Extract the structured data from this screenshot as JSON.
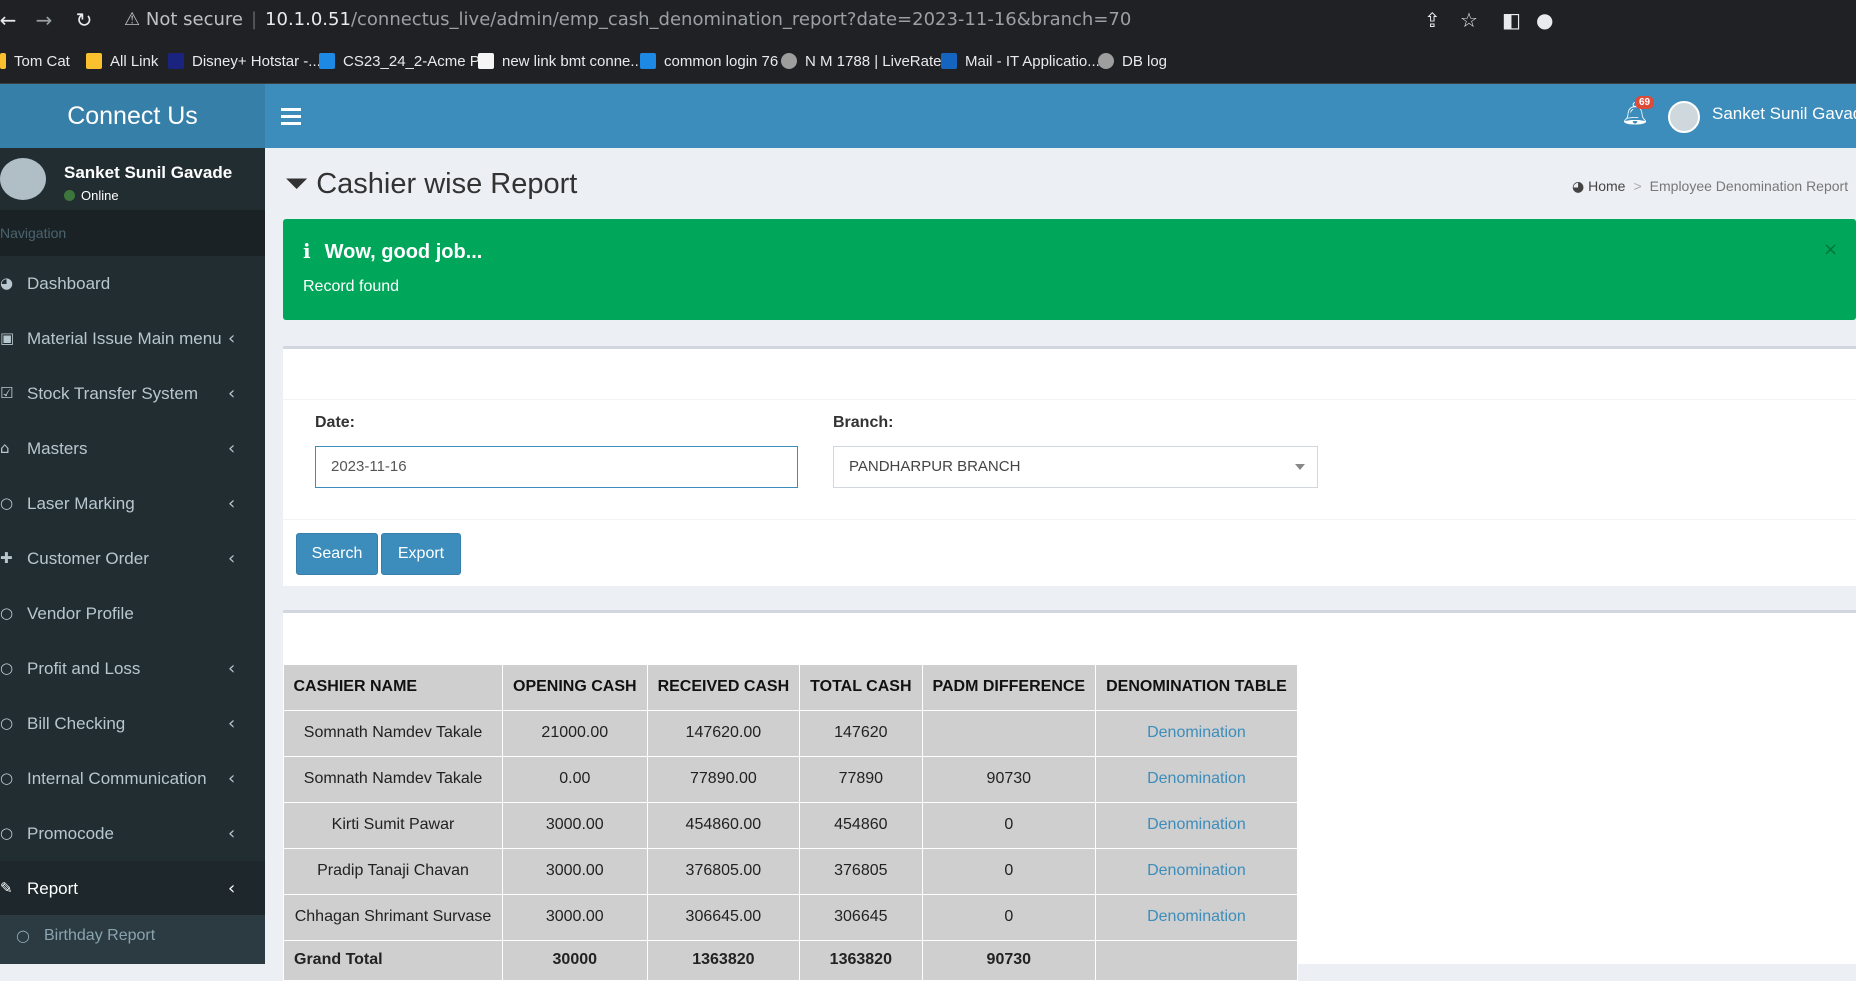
{
  "browser": {
    "not_secure": "Not secure",
    "host": "10.1.0.51",
    "path": "/connectus_live/admin/emp_cash_denomination_report?date=2023-11-16&branch=70",
    "bookmarks": [
      {
        "label": "Tom Cat",
        "color": "#fbc02d"
      },
      {
        "label": "All Link",
        "color": "#fbc02d"
      },
      {
        "label": "Disney+ Hotstar -...",
        "color": "#1a237e"
      },
      {
        "label": "CS23_24_2-Acme P...",
        "color": "#1e88e5"
      },
      {
        "label": "new link bmt conne...",
        "color": "#f5f5f5"
      },
      {
        "label": "common login 76",
        "color": "#1e88e5"
      },
      {
        "label": "N M 1788 | LiveRates",
        "color": "#9e9e9e"
      },
      {
        "label": "Mail - IT Applicatio...",
        "color": "#1565c0"
      },
      {
        "label": "DB log",
        "color": "#9e9e9e"
      }
    ]
  },
  "app": {
    "logo": "Connect Us",
    "notification_count": "69",
    "user_name": "Sanket Sunil Gavade",
    "user_status": "Online",
    "nav_header": "Navigation"
  },
  "sidebar": {
    "items": [
      {
        "label": "Dashboard",
        "icon": "dashboard-icon",
        "glyph": "◕",
        "chevron": false
      },
      {
        "label": "Material Issue Main menu",
        "icon": "money-icon",
        "glyph": "▣",
        "chevron": true
      },
      {
        "label": "Stock Transfer System",
        "icon": "check-square-icon",
        "glyph": "☑",
        "chevron": true
      },
      {
        "label": "Masters",
        "icon": "home-icon",
        "glyph": "⌂",
        "chevron": true
      },
      {
        "label": "Laser Marking",
        "icon": "circle-icon",
        "glyph": "○",
        "chevron": true
      },
      {
        "label": "Customer Order",
        "icon": "plus-icon",
        "glyph": "✚",
        "chevron": true
      },
      {
        "label": "Vendor Profile",
        "icon": "circle-icon",
        "glyph": "○",
        "chevron": false
      },
      {
        "label": "Profit and Loss",
        "icon": "circle-icon",
        "glyph": "○",
        "chevron": true
      },
      {
        "label": "Bill Checking",
        "icon": "circle-icon",
        "glyph": "○",
        "chevron": true
      },
      {
        "label": "Internal Communication",
        "icon": "circle-icon",
        "glyph": "○",
        "chevron": true
      },
      {
        "label": "Promocode",
        "icon": "circle-icon",
        "glyph": "○",
        "chevron": true
      },
      {
        "label": "Report",
        "icon": "edit-icon",
        "glyph": "✎",
        "chevron": true,
        "active": true
      }
    ],
    "submenu_item": "Birthday Report"
  },
  "page": {
    "title": "Cashier wise Report",
    "breadcrumb_home": "Home",
    "breadcrumb_current": "Employee Denomination Report"
  },
  "alert": {
    "title": "Wow, good job...",
    "message": "Record found",
    "close": "×"
  },
  "filters": {
    "date_label": "Date:",
    "date_value": "2023-11-16",
    "branch_label": "Branch:",
    "branch_value": "PANDHARPUR BRANCH",
    "search_label": "Search",
    "export_label": "Export"
  },
  "table": {
    "headers": [
      "CASHIER NAME",
      "OPENING CASH",
      "RECEIVED CASH",
      "TOTAL CASH",
      "PADM DIFFERENCE",
      "DENOMINATION TABLE"
    ],
    "rows": [
      [
        "Somnath Namdev Takale",
        "21000.00",
        "147620.00",
        "147620",
        "",
        "Denomination"
      ],
      [
        "Somnath Namdev Takale",
        "0.00",
        "77890.00",
        "77890",
        "90730",
        "Denomination"
      ],
      [
        "Kirti Sumit Pawar",
        "3000.00",
        "454860.00",
        "454860",
        "0",
        "Denomination"
      ],
      [
        "Pradip Tanaji Chavan",
        "3000.00",
        "376805.00",
        "376805",
        "0",
        "Denomination"
      ],
      [
        "Chhagan Shrimant Survase",
        "3000.00",
        "306645.00",
        "306645",
        "0",
        "Denomination"
      ]
    ],
    "total": [
      "Grand Total",
      "30000",
      "1363820",
      "1363820",
      "90730",
      ""
    ]
  }
}
